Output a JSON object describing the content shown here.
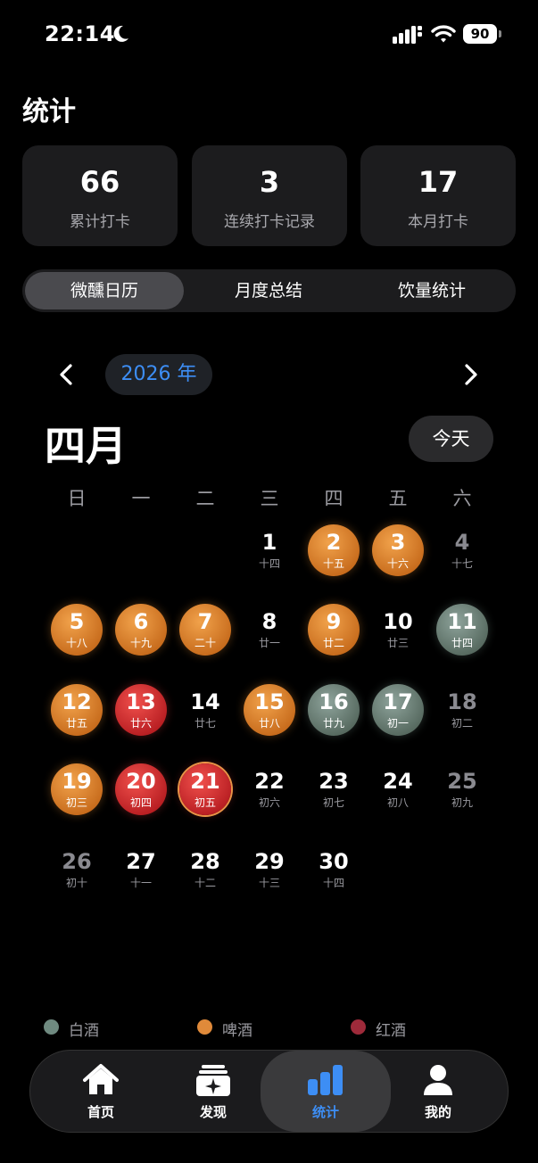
{
  "status": {
    "time": "22:14",
    "battery": "90"
  },
  "page_title": "统计",
  "stats": [
    {
      "value": "66",
      "label": "累计打卡"
    },
    {
      "value": "3",
      "label": "连续打卡记录"
    },
    {
      "value": "17",
      "label": "本月打卡"
    }
  ],
  "segments": [
    "微醺日历",
    "月度总结",
    "饮量统计"
  ],
  "calendar": {
    "year": "2026 年",
    "month": "四月",
    "today_label": "今天",
    "weekdays": [
      "日",
      "一",
      "二",
      "三",
      "四",
      "五",
      "六"
    ],
    "days": [
      {
        "d": "1",
        "l": "十四",
        "t": ""
      },
      {
        "d": "2",
        "l": "十五",
        "t": "beer"
      },
      {
        "d": "3",
        "l": "十六",
        "t": "beer"
      },
      {
        "d": "4",
        "l": "十七",
        "t": "dim"
      },
      {
        "d": "5",
        "l": "十八",
        "t": "beer"
      },
      {
        "d": "6",
        "l": "十九",
        "t": "beer"
      },
      {
        "d": "7",
        "l": "二十",
        "t": "beer"
      },
      {
        "d": "8",
        "l": "廿一",
        "t": ""
      },
      {
        "d": "9",
        "l": "廿二",
        "t": "beer"
      },
      {
        "d": "10",
        "l": "廿三",
        "t": ""
      },
      {
        "d": "11",
        "l": "廿四",
        "t": "baijiu"
      },
      {
        "d": "12",
        "l": "廿五",
        "t": "beer"
      },
      {
        "d": "13",
        "l": "廿六",
        "t": "red"
      },
      {
        "d": "14",
        "l": "廿七",
        "t": ""
      },
      {
        "d": "15",
        "l": "廿八",
        "t": "beer"
      },
      {
        "d": "16",
        "l": "廿九",
        "t": "baijiu"
      },
      {
        "d": "17",
        "l": "初一",
        "t": "baijiu"
      },
      {
        "d": "18",
        "l": "初二",
        "t": "dim"
      },
      {
        "d": "19",
        "l": "初三",
        "t": "beer"
      },
      {
        "d": "20",
        "l": "初四",
        "t": "red"
      },
      {
        "d": "21",
        "l": "初五",
        "t": "red ring"
      },
      {
        "d": "22",
        "l": "初六",
        "t": ""
      },
      {
        "d": "23",
        "l": "初七",
        "t": ""
      },
      {
        "d": "24",
        "l": "初八",
        "t": ""
      },
      {
        "d": "25",
        "l": "初九",
        "t": "dim"
      },
      {
        "d": "26",
        "l": "初十",
        "t": "dim"
      },
      {
        "d": "27",
        "l": "十一",
        "t": ""
      },
      {
        "d": "28",
        "l": "十二",
        "t": ""
      },
      {
        "d": "29",
        "l": "十三",
        "t": ""
      },
      {
        "d": "30",
        "l": "十四",
        "t": ""
      }
    ]
  },
  "legend": [
    {
      "label": "白酒",
      "color": "#6f8a80"
    },
    {
      "label": "啤酒",
      "color": "#e08a3a"
    },
    {
      "label": "红酒",
      "color": "#9e2a3a"
    }
  ],
  "tabs": [
    {
      "label": "首页",
      "icon": "home-icon"
    },
    {
      "label": "发现",
      "icon": "discover-icon"
    },
    {
      "label": "统计",
      "icon": "chart-icon"
    },
    {
      "label": "我的",
      "icon": "profile-icon"
    }
  ]
}
